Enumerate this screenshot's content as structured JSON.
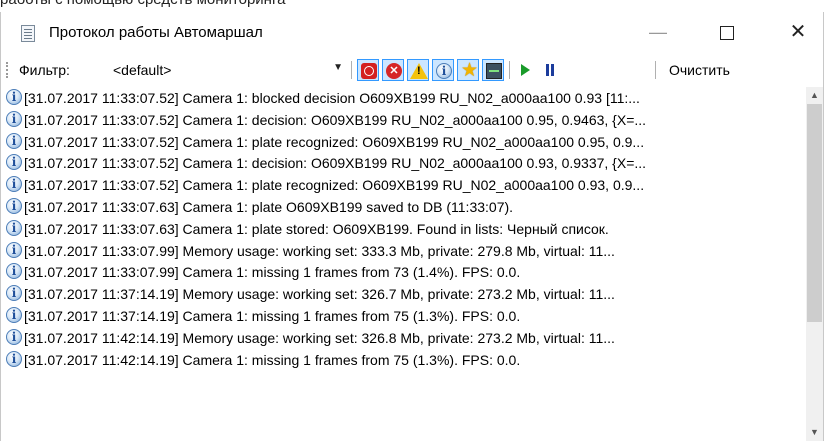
{
  "background_text": "работы с помощью средств мониторинга",
  "window": {
    "title": "Протокол работы Автомаршал",
    "minimize_glyph": "—",
    "close_glyph": "✕"
  },
  "toolbar": {
    "filter_label": "Фильтр:",
    "filter_value": "<default>",
    "clear_label": "Очистить",
    "icons": [
      "stop-icon",
      "error-icon",
      "warning-icon",
      "info-icon",
      "star-icon",
      "monitor-icon",
      "play-icon",
      "pause-icon"
    ],
    "info_glyph": "i",
    "error_glyph": "✕",
    "star_glyph": "★"
  },
  "log": {
    "entries": [
      "[31.07.2017 11:33:07.52] Camera 1: blocked decision O609XB199 RU_N02_a000aa100 0.93 [11:...",
      "[31.07.2017 11:33:07.52] Camera 1: decision: O609XB199 RU_N02_a000aa100 0.95, 0.9463, {X=...",
      "[31.07.2017 11:33:07.52] Camera 1: plate recognized: O609XB199 RU_N02_a000aa100 0.95, 0.9...",
      "[31.07.2017 11:33:07.52] Camera 1: decision: O609XB199 RU_N02_a000aa100 0.93, 0.9337, {X=...",
      "[31.07.2017 11:33:07.52] Camera 1: plate recognized: O609XB199 RU_N02_a000aa100 0.93, 0.9...",
      "[31.07.2017 11:33:07.63] Camera 1: plate O609XB199 saved to DB (11:33:07).",
      "[31.07.2017 11:33:07.63] Camera 1: plate stored: O609XB199. Found in lists: Черный список.",
      "[31.07.2017 11:33:07.99] Memory usage: working set: 333.3 Mb, private: 279.8 Mb, virtual: 11...",
      "[31.07.2017 11:33:07.99] Camera 1: missing 1 frames from 73 (1.4%). FPS: 0.0.",
      "[31.07.2017 11:37:14.19] Memory usage: working set: 326.7 Mb, private: 273.2 Mb, virtual: 11...",
      "[31.07.2017 11:37:14.19] Camera 1: missing 1 frames from 75 (1.3%). FPS: 0.0.",
      "[31.07.2017 11:42:14.19] Memory usage: working set: 326.8 Mb, private: 273.2 Mb, virtual: 11...",
      "[31.07.2017 11:42:14.19] Camera 1: missing 1 frames from 75 (1.3%). FPS: 0.0."
    ]
  },
  "scrollbar": {
    "up_glyph": "▲",
    "down_glyph": "▼"
  }
}
